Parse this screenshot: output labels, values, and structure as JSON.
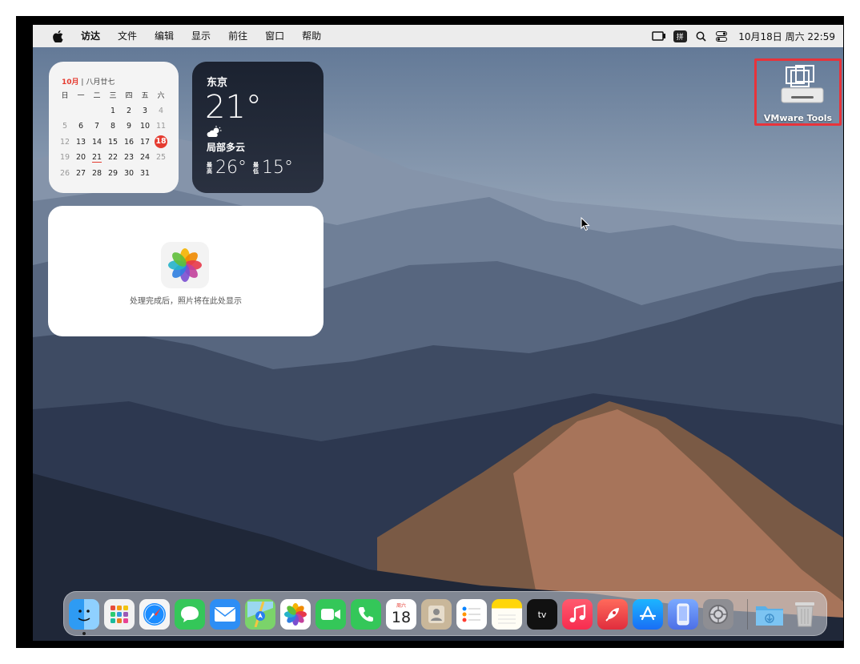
{
  "menubar": {
    "app_name": "访达",
    "menus": [
      "文件",
      "编辑",
      "显示",
      "前往",
      "窗口",
      "帮助"
    ],
    "input_method": "拼",
    "clock": "10月18日 周六  22:59"
  },
  "calendar_widget": {
    "month": "10月",
    "lunar": "八月廿七",
    "weekdays": [
      "日",
      "一",
      "二",
      "三",
      "四",
      "五",
      "六"
    ],
    "weeks": [
      [
        "",
        "",
        "",
        "1",
        "2",
        "3",
        "4"
      ],
      [
        "5",
        "6",
        "7",
        "8",
        "9",
        "10",
        "11"
      ],
      [
        "12",
        "13",
        "14",
        "15",
        "16",
        "17",
        "18"
      ],
      [
        "19",
        "20",
        "21",
        "22",
        "23",
        "24",
        "25"
      ],
      [
        "26",
        "27",
        "28",
        "29",
        "30",
        "31",
        ""
      ]
    ],
    "today": "18"
  },
  "weather_widget": {
    "city": "东京",
    "temperature": "21°",
    "condition": "局部多云",
    "high_label": "最高",
    "high": "26°",
    "low_label": "最低",
    "low": "15°"
  },
  "photos_widget": {
    "message": "处理完成后，照片将在此处显示"
  },
  "desktop": {
    "vmware_label": "VMware Tools"
  },
  "dock": {
    "calendar_weekday": "周六",
    "calendar_day": "18",
    "apps": [
      "finder-icon",
      "launchpad-icon",
      "safari-icon",
      "messages-icon",
      "mail-icon",
      "maps-icon",
      "photos-icon",
      "facetime-icon",
      "phone-icon",
      "calendar-icon",
      "contacts-icon",
      "reminders-icon",
      "notes-icon",
      "appletv-icon",
      "music-icon",
      "rocket-icon",
      "appstore-icon",
      "iphone-mirroring-icon",
      "system-settings-icon",
      "downloads-folder-icon",
      "trash-icon"
    ]
  },
  "colors": {
    "accent_red": "#e53b30",
    "highlight_box": "#e8333a"
  }
}
